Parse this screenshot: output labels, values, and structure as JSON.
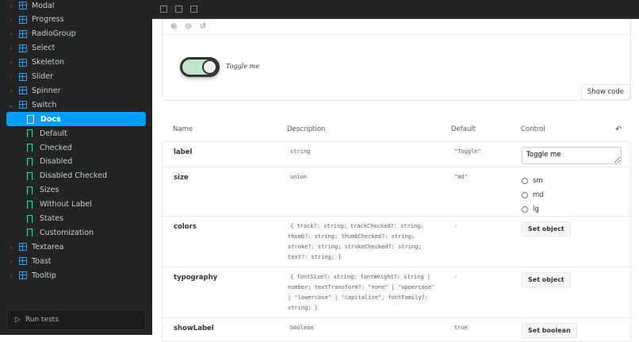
{
  "sidebar": {
    "items": [
      {
        "label": "Modal",
        "type": "component"
      },
      {
        "label": "Progress",
        "type": "component"
      },
      {
        "label": "RadioGroup",
        "type": "component"
      },
      {
        "label": "Select",
        "type": "component"
      },
      {
        "label": "Skeleton",
        "type": "component"
      },
      {
        "label": "Slider",
        "type": "component"
      },
      {
        "label": "Spinner",
        "type": "component"
      },
      {
        "label": "Switch",
        "type": "component",
        "expanded": true
      },
      {
        "label": "Docs",
        "type": "docs",
        "selected": true
      },
      {
        "label": "Default",
        "type": "story"
      },
      {
        "label": "Checked",
        "type": "story"
      },
      {
        "label": "Disabled",
        "type": "story"
      },
      {
        "label": "Disabled Checked",
        "type": "story"
      },
      {
        "label": "Sizes",
        "type": "story"
      },
      {
        "label": "Without Label",
        "type": "story"
      },
      {
        "label": "States",
        "type": "story"
      },
      {
        "label": "Customization",
        "type": "story"
      },
      {
        "label": "Textarea",
        "type": "component"
      },
      {
        "label": "Toast",
        "type": "component"
      },
      {
        "label": "Tooltip",
        "type": "component"
      }
    ],
    "run_tests": "Run tests"
  },
  "preview": {
    "switch_label": "Toggle me",
    "switch_checked": true,
    "show_code": "Show code"
  },
  "table": {
    "headers": {
      "name": "Name",
      "description": "Description",
      "default": "Default",
      "control": "Control"
    },
    "rows": [
      {
        "name": "label",
        "description": "string",
        "default": "\"Toggle\"",
        "control_value": "Toggle me"
      },
      {
        "name": "size",
        "description": "union",
        "default": "\"md\"",
        "options": [
          "sm",
          "md",
          "lg"
        ]
      },
      {
        "name": "colors",
        "description": "{ track?: string; trackChecked?: string; thumb?: string; thumbChecked?: string; stroke?: string; strokeChecked?: string; text?: string; }",
        "default": "-",
        "button": "Set object"
      },
      {
        "name": "typography",
        "description": "{ fontSize?: string; fontWeight?: string | number; textTransform?: \"none\" | \"uppercase\" | \"lowercase\" | \"capitalize\"; fontFamily?: string; }",
        "default": "-",
        "button": "Set object"
      },
      {
        "name": "showLabel",
        "description": "boolean",
        "default": "true",
        "button": "Set boolean"
      }
    ]
  },
  "colors": {
    "accent": "#029cfd",
    "sidebar_bg": "#222425"
  }
}
